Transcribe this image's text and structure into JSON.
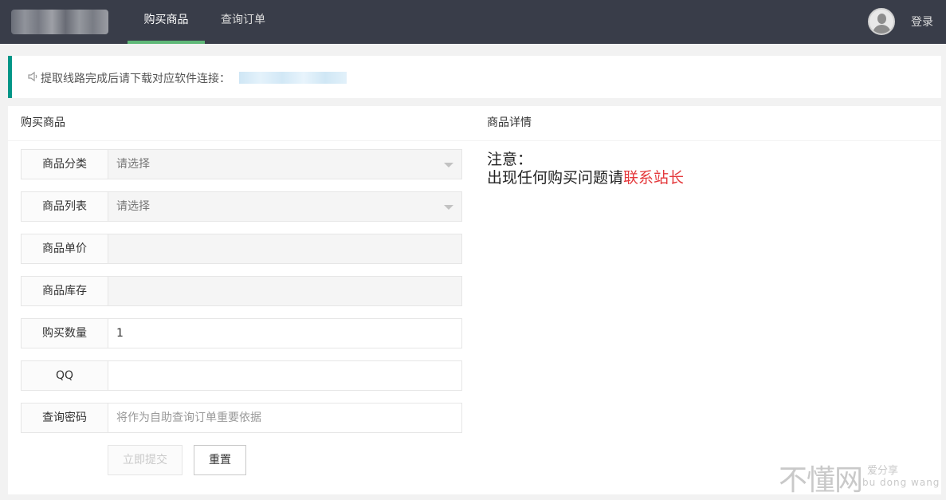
{
  "header": {
    "nav": [
      {
        "label": "购买商品",
        "active": true
      },
      {
        "label": "查询订单",
        "active": false
      }
    ],
    "login_label": "登录"
  },
  "notice": {
    "icon": "speaker-icon",
    "text": "提取线路完成后请下载对应软件连接："
  },
  "buy_panel": {
    "title": "购买商品",
    "fields": [
      {
        "label": "商品分类",
        "value": "请选择",
        "type": "select"
      },
      {
        "label": "商品列表",
        "value": "请选择",
        "type": "select"
      },
      {
        "label": "商品单价",
        "value": "",
        "type": "readonly"
      },
      {
        "label": "商品库存",
        "value": "",
        "type": "readonly"
      },
      {
        "label": "购买数量",
        "value": "1",
        "type": "input"
      },
      {
        "label": "QQ",
        "value": "",
        "type": "input"
      },
      {
        "label": "查询密码",
        "placeholder": "将作为自助查询订单重要依据",
        "type": "input"
      }
    ],
    "submit_label": "立即提交",
    "reset_label": "重置"
  },
  "detail_panel": {
    "title": "商品详情",
    "note_heading": "注意：",
    "note_text": "出现任何购买问题请",
    "note_link": "联系站长"
  },
  "watermark": {
    "main": "不懂网",
    "sub1": "爱分享",
    "sub2": "bu dong wang"
  },
  "colors": {
    "topbar": "#393d49",
    "active_underline": "#5fb878",
    "notice_accent": "#009688",
    "link_red": "#e4393c"
  }
}
